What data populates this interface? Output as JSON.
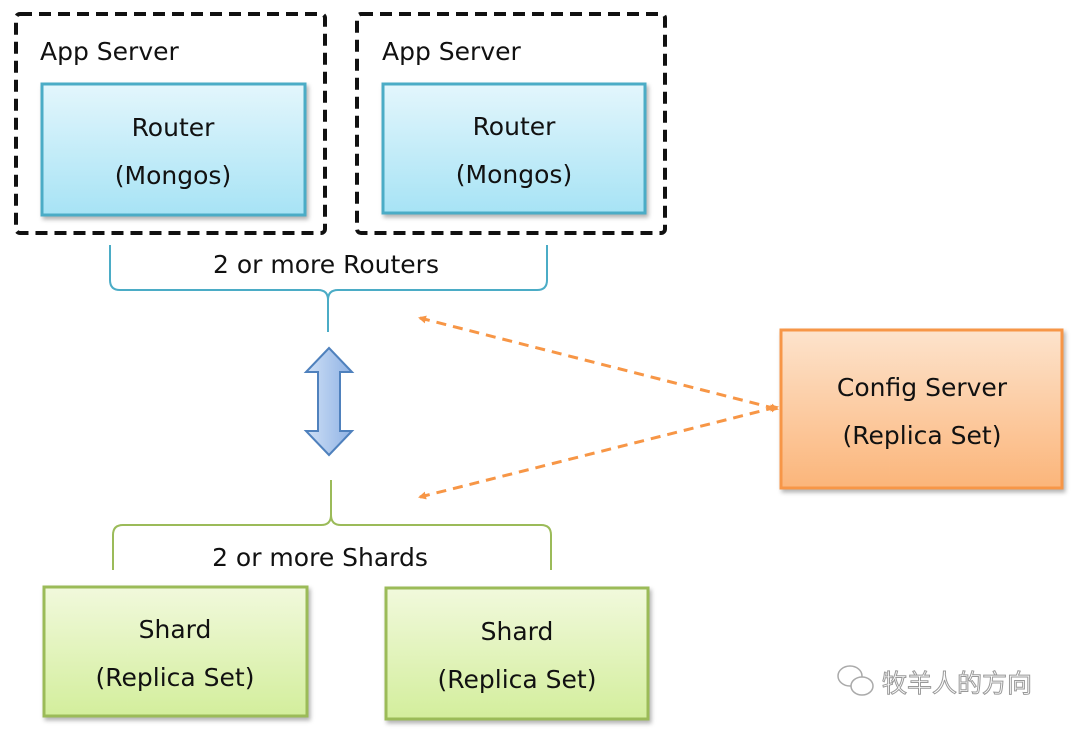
{
  "app_servers": [
    {
      "label": "App Server",
      "router_title": "Router",
      "router_subtitle": "(Mongos)"
    },
    {
      "label": "App Server",
      "router_title": "Router",
      "router_subtitle": "(Mongos)"
    }
  ],
  "routers_brace_label": "2 or more Routers",
  "shards_brace_label": "2 or more Shards",
  "shards": [
    {
      "title": "Shard",
      "subtitle": "(Replica Set)"
    },
    {
      "title": "Shard",
      "subtitle": "(Replica Set)"
    }
  ],
  "config_server": {
    "title": "Config Server",
    "subtitle": "(Replica Set)"
  },
  "watermark": "牧羊人的方向",
  "colors": {
    "router": "#4bacc6",
    "shard": "#9bbb59",
    "config": "#f79646",
    "arrow": "#f79646",
    "double_arrow": "#4f81bd"
  }
}
